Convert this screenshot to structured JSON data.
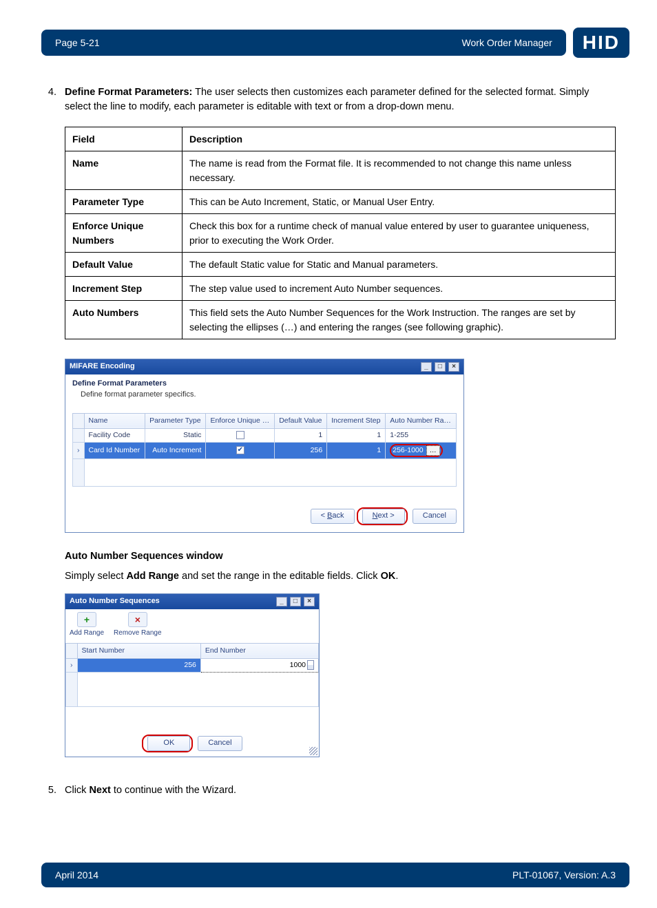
{
  "header": {
    "page_label": "Page 5-21",
    "doc_title": "Work Order Manager",
    "logo_text": "HID"
  },
  "step4": {
    "number": "4.",
    "lead": "Define Format Parameters:",
    "text": " The user selects then customizes each parameter defined for the selected format. Simply select the line to modify, each parameter is editable with text or from a drop-down menu."
  },
  "field_table": {
    "head_field": "Field",
    "head_desc": "Description",
    "rows": [
      {
        "field": "Name",
        "desc": "The name is read from the Format file. It is recommended to not change this name unless necessary."
      },
      {
        "field": "Parameter Type",
        "desc": "This can be Auto Increment, Static, or Manual User Entry."
      },
      {
        "field": "Enforce Unique Numbers",
        "desc": "Check this box for a runtime check of manual value entered by user to guarantee uniqueness, prior to executing the Work Order."
      },
      {
        "field": "Default Value",
        "desc": "The default Static value for Static and Manual parameters."
      },
      {
        "field": "Increment Step",
        "desc": "The step value used to increment Auto Number sequences."
      },
      {
        "field": "Auto Numbers",
        "desc": "This field sets the Auto Number Sequences for the Work Instruction. The ranges are set by selecting the ellipses (…) and entering the ranges (see following graphic)."
      }
    ]
  },
  "dialog1": {
    "title": "MIFARE Encoding",
    "section_head": "Define Format Parameters",
    "section_sub": "Define format parameter specifics.",
    "columns": [
      "Name",
      "Parameter Type",
      "Enforce Unique …",
      "Default Value",
      "Increment Step",
      "Auto Number Ra…"
    ],
    "row1": {
      "name": "Facility Code",
      "ptype": "Static",
      "enforce": false,
      "default": "1",
      "step": "1",
      "range": "1-255"
    },
    "row2": {
      "name": "Card Id Number",
      "ptype": "Auto Increment",
      "enforce": true,
      "default": "256",
      "step": "1",
      "range": "256-1000"
    },
    "btn_back": "< Back",
    "btn_next_u": "N",
    "btn_next_rest": "ext >",
    "btn_cancel": "Cancel",
    "ellipsis": "…"
  },
  "section2": {
    "heading": "Auto Number Sequences window",
    "line_a": "Simply select ",
    "bold_a": "Add Range",
    "line_b": " and set the range in the editable fields. Click ",
    "bold_b": "OK",
    "line_c": "."
  },
  "dialog2": {
    "title": "Auto Number Sequences",
    "add": "Add Range",
    "remove": "Remove Range",
    "col_start": "Start Number",
    "col_end": "End Number",
    "start_val": "256",
    "end_val": "1000",
    "btn_ok": "OK",
    "btn_cancel": "Cancel"
  },
  "step5": {
    "number": "5.",
    "pre": "Click ",
    "bold": "Next",
    "post": " to continue with the Wizard."
  },
  "footer": {
    "left": "April 2014",
    "right": "PLT-01067, Version: A.3"
  }
}
